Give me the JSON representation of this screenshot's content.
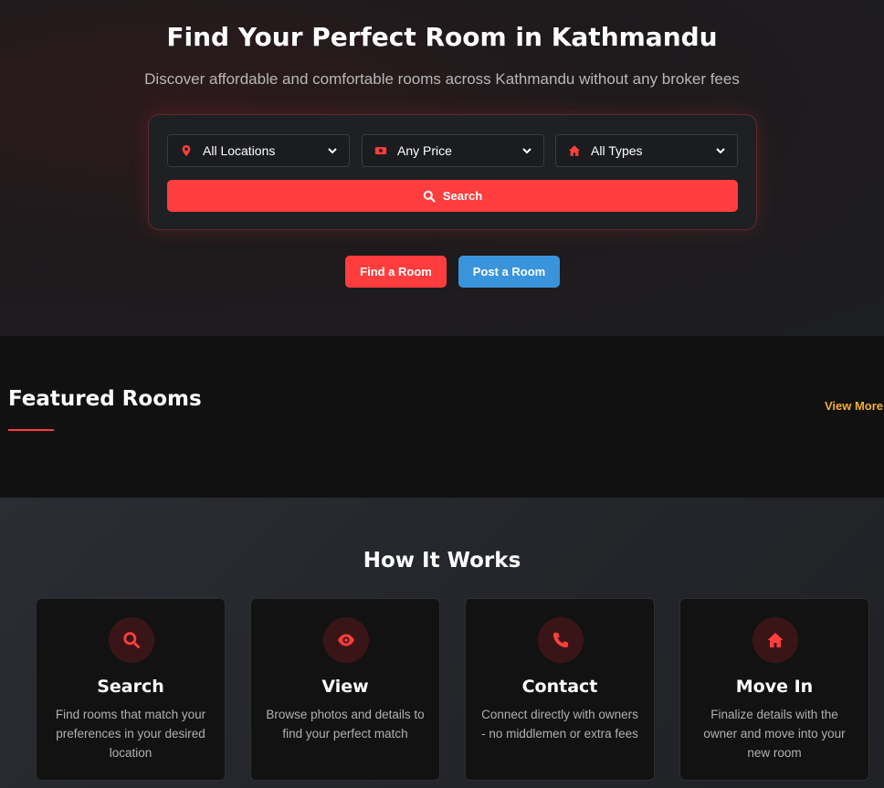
{
  "hero": {
    "title": "Find Your Perfect Room in Kathmandu",
    "subtitle": "Discover affordable and comfortable rooms across Kathmandu without any broker fees"
  },
  "search": {
    "location": {
      "label": "All Locations",
      "icon": "map-pin-icon"
    },
    "price": {
      "label": "Any Price",
      "icon": "money-icon"
    },
    "type": {
      "label": "All Types",
      "icon": "home-icon"
    },
    "button_label": "Search"
  },
  "cta": {
    "find_label": "Find a Room",
    "post_label": "Post a Room"
  },
  "featured": {
    "title": "Featured Rooms",
    "view_more": "View More"
  },
  "how": {
    "title": "How It Works",
    "steps": [
      {
        "icon": "search-icon",
        "title": "Search",
        "desc": "Find rooms that match your preferences in your desired location"
      },
      {
        "icon": "eye-icon",
        "title": "View",
        "desc": "Browse photos and details to find your perfect match"
      },
      {
        "icon": "phone-icon",
        "title": "Contact",
        "desc": "Connect directly with owners - no middlemen or extra fees"
      },
      {
        "icon": "home-icon",
        "title": "Move In",
        "desc": "Finalize details with the owner and move into your new room"
      }
    ]
  },
  "colors": {
    "accent": "#ff3d3d",
    "secondary": "#3a94dc",
    "link": "#f2b02b"
  }
}
